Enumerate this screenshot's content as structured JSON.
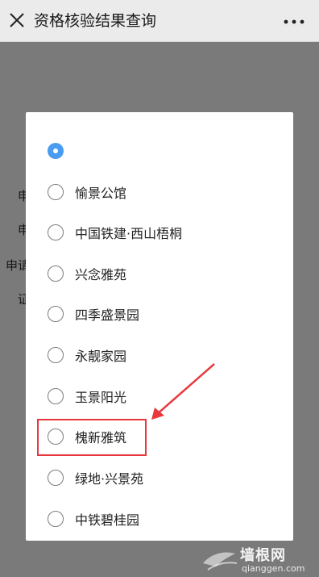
{
  "header": {
    "title": "资格核验结果查询",
    "close_icon": "close-icon",
    "more_icon": "more-icon"
  },
  "background_labels": [
    "申",
    "申",
    "申请",
    "证"
  ],
  "dialog": {
    "selected_index": 0,
    "options": [
      {
        "label": ""
      },
      {
        "label": "愉景公馆"
      },
      {
        "label": "中国铁建·西山梧桐"
      },
      {
        "label": "兴念雅苑"
      },
      {
        "label": "四季盛景园"
      },
      {
        "label": "永靓家园"
      },
      {
        "label": "玉景阳光"
      },
      {
        "label": "槐新雅筑"
      },
      {
        "label": "绿地·兴景苑"
      },
      {
        "label": "中铁碧桂园"
      }
    ],
    "highlighted_label": "槐新雅筑"
  },
  "watermark": {
    "main": "墙根网",
    "sub": "qianggen.com"
  },
  "colors": {
    "accent": "#4a9cf0",
    "highlight": "#e8383d"
  }
}
